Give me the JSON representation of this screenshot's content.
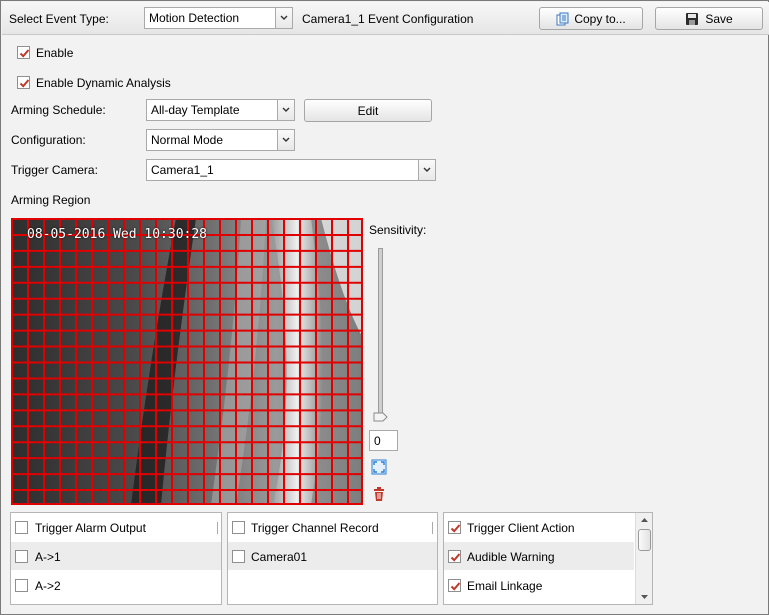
{
  "toolbar": {
    "event_type_label": "Select Event Type:",
    "event_type_value": "Motion Detection",
    "config_title": "Camera1_1 Event Configuration",
    "copy_label": "Copy to...",
    "save_label": "Save"
  },
  "form": {
    "enable_label": "Enable",
    "enable_checked": true,
    "dynamic_label": "Enable Dynamic Analysis",
    "dynamic_checked": true,
    "schedule_label": "Arming Schedule:",
    "schedule_value": "All-day Template",
    "edit_label": "Edit",
    "configuration_label": "Configuration:",
    "configuration_value": "Normal Mode",
    "trigger_camera_label": "Trigger Camera:",
    "trigger_camera_value": "Camera1_1",
    "region_label": "Arming Region"
  },
  "video": {
    "timestamp": "08-05-2016 Wed 10:30:28",
    "grid_color": "#e00000"
  },
  "sensitivity": {
    "label": "Sensitivity:",
    "value": "0",
    "level": 0
  },
  "panels": {
    "alarm": {
      "header": "Trigger Alarm Output",
      "items": [
        {
          "label": "A->1",
          "checked": false
        },
        {
          "label": "A->2",
          "checked": false
        }
      ]
    },
    "record": {
      "header": "Trigger Channel Record",
      "items": [
        {
          "label": "Camera01",
          "checked": false
        }
      ]
    },
    "client": {
      "header": "Trigger Client Action",
      "header_checked": true,
      "items": [
        {
          "label": "Audible Warning",
          "checked": true
        },
        {
          "label": "Email Linkage",
          "checked": true
        }
      ]
    }
  },
  "colors": {
    "check": "#c0392b",
    "accent_icon": "#2a7fd4"
  }
}
